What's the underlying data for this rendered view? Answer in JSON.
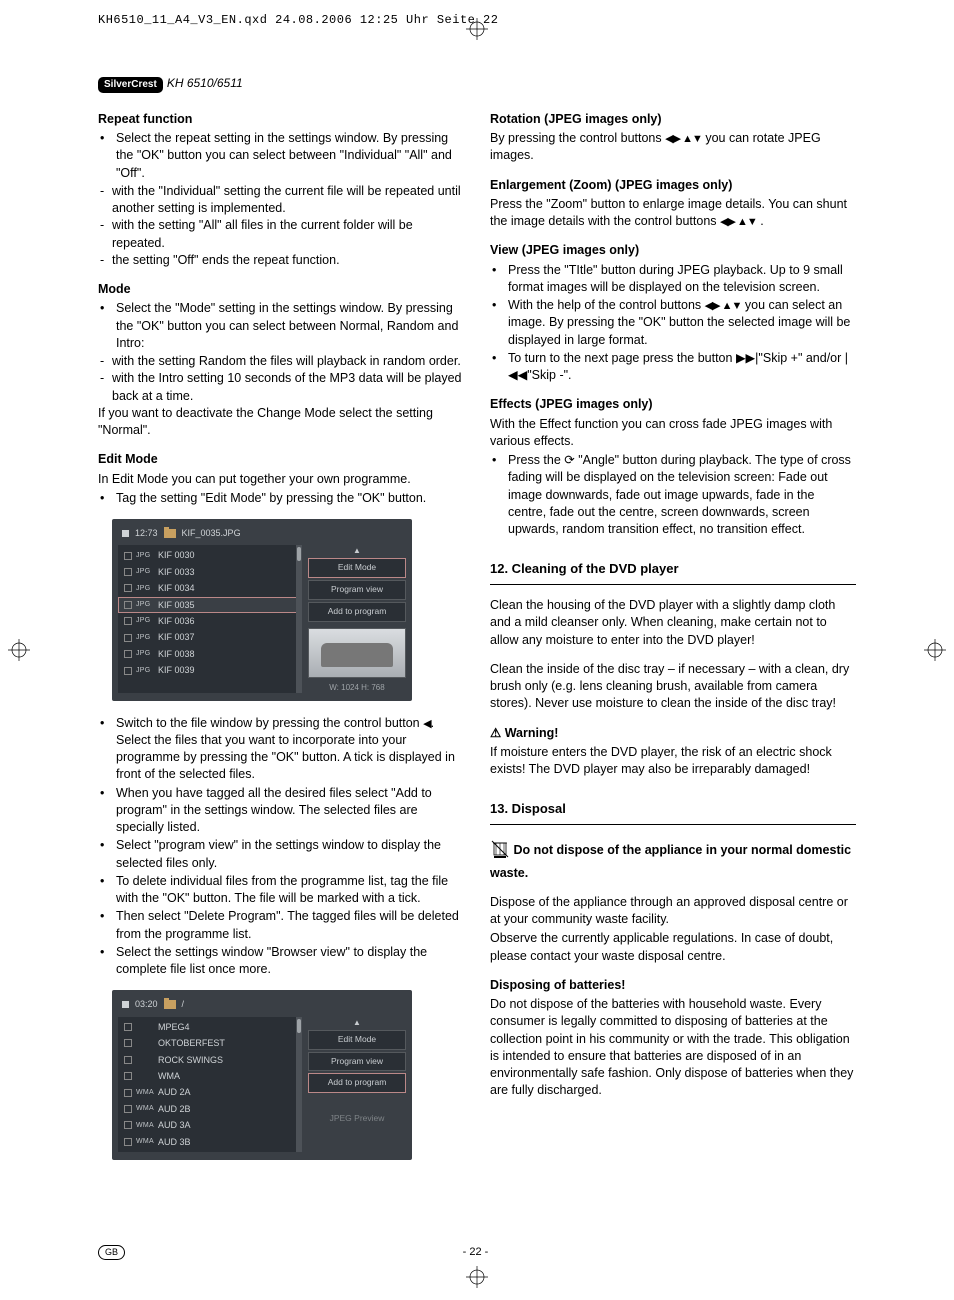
{
  "meta": {
    "crop_header": "KH6510_11_A4_V3_EN.qxd  24.08.2006  12:25 Uhr  Seite 22",
    "brand_badge": "SilverCrest",
    "model": "KH 6510/6511",
    "page_label": "- 22 -",
    "lang_badge": "GB"
  },
  "glyphs": {
    "lr": "◀▶",
    "ud": "▲▼",
    "left": "◀",
    "skip_fwd": "▶▶|",
    "skip_back": "|◀◀",
    "angle": "⟳",
    "warning": "⚠"
  },
  "left": {
    "repeat": {
      "title": "Repeat function",
      "b1": "Select the repeat setting in the settings window. By pressing the \"OK\" button you can select between \"Individual\" \"All\" and \"Off\".",
      "d1": "with the \"Individual\" setting the current file will be repeated until another setting is implemented.",
      "d2": "with the setting \"All\" all files in the current folder will be repeated.",
      "d3": "the setting \"Off\" ends the repeat function."
    },
    "mode": {
      "title": "Mode",
      "b1": "Select the \"Mode\" setting in the settings window. By pressing the \"OK\" button you can select between Normal, Random and Intro:",
      "d1": "with the setting Random the files will playback in random order.",
      "d2": "with the Intro setting 10 seconds of the MP3 data will be played back at a time.",
      "p1": "If you want to deactivate the Change Mode select the setting \"Normal\"."
    },
    "edit": {
      "title": "Edit Mode",
      "p1": "In Edit Mode you can put together your own programme.",
      "b1": "Tag the setting \"Edit Mode\" by pressing the \"OK\" button.",
      "b2a": "Switch to the file window by pressing the control button ",
      "b2b": ". Select the files that you want to incorporate into your programme by pressing the \"OK\" button. A tick is displayed in front of the selected files.",
      "b3": "When you have tagged all the desired files select \"Add to program\" in the settings window. The selected files are specially listed.",
      "b4": "Select \"program view\" in the settings window to display the selected files only.",
      "b5": "To delete individual files from the programme list, tag the file with the \"OK\" button. The file will be marked with a tick.",
      "b6": "Then select \"Delete Program\". The tagged files will be deleted from the programme list.",
      "b7": "Select the settings window \"Browser view\" to display the complete file list once more."
    }
  },
  "right": {
    "rotation": {
      "title": "Rotation (JPEG images only)",
      "p1a": "By pressing the control buttons ",
      "p1b": " you can rotate JPEG images."
    },
    "zoom": {
      "title": "Enlargement (Zoom) (JPEG images only)",
      "p1a": "Press the \"Zoom\" button to enlarge image details. You can shunt the image details with the control buttons ",
      "p1b": " ."
    },
    "view": {
      "title": "View (JPEG images only)",
      "b1": "Press the \"TItle\" button during JPEG playback. Up to 9 small format images will be displayed on the television screen.",
      "b2a": "With the help of the control buttons ",
      "b2b": " you can select an image. By pressing the \"OK\" button the selected image will be displayed in large format.",
      "b3a": "To turn to the next page press the button ",
      "b3b": "\"Skip +\" and/or ",
      "b3c": "\"Skip -\"."
    },
    "effects": {
      "title": "Effects (JPEG images only)",
      "p1": "With the Effect function you can cross fade JPEG images with various effects.",
      "b1a": "Press the ",
      "b1b": " \"Angle\" button during playback. The type of cross fading will be displayed on the television screen: Fade out image downwards, fade out image upwards, fade in the centre, fade out the centre, screen downwards, screen upwards, random transition effect, no transition effect."
    },
    "cleaning": {
      "title": "12. Cleaning of the DVD player",
      "p1": "Clean the housing of the DVD player with a slightly damp cloth and a mild cleanser only. When cleaning, make certain not to allow any moisture to enter into the DVD player!",
      "p2": "Clean the inside of the disc tray – if necessary –  with a clean, dry brush only (e.g. lens cleaning brush, available from camera stores). Never use moisture to clean the inside of the disc tray!",
      "warn_title": "Warning!",
      "warn_body": "If moisture enters the DVD player, the risk of an electric shock exists! The DVD player may also be irreparably damaged!"
    },
    "disposal": {
      "title": "13. Disposal",
      "bold": "Do not dispose of the appliance in your normal domestic waste.",
      "p1": "Dispose of the appliance through an approved disposal centre or at your community waste facility.",
      "p2": "Observe the currently applicable regulations. In case of doubt, please contact your waste disposal centre.",
      "bat_title": "Disposing of batteries!",
      "bat_body": "Do not dispose of the batteries with household waste. Every consumer is legally committed to disposing of batteries at the collection point in his community or with the trade. This obligation is intended to ensure that batteries are disposed of in an environmentally safe fashion. Only dispose of batteries when they are fully discharged."
    }
  },
  "ss1": {
    "counter": "12:73",
    "current": "KIF_0035.JPG",
    "btn1": "Edit Mode",
    "btn2": "Program view",
    "btn3": "Add to program",
    "dim": "W: 1024  H: 768",
    "files": [
      {
        "tag": "JPG",
        "name": "KIF  0030"
      },
      {
        "tag": "JPG",
        "name": "KIF  0033"
      },
      {
        "tag": "JPG",
        "name": "KIF  0034"
      },
      {
        "tag": "JPG",
        "name": "KIF  0035"
      },
      {
        "tag": "JPG",
        "name": "KIF  0036"
      },
      {
        "tag": "JPG",
        "name": "KIF  0037"
      },
      {
        "tag": "JPG",
        "name": "KIF  0038"
      },
      {
        "tag": "JPG",
        "name": "KIF  0039"
      }
    ],
    "selected_index": 3
  },
  "ss2": {
    "counter": "03:20",
    "current": "/",
    "btn1": "Edit Mode",
    "btn2": "Program view",
    "btn3": "Add to program",
    "preview": "JPEG Preview",
    "files": [
      {
        "tag": "",
        "name": "MPEG4"
      },
      {
        "tag": "",
        "name": "OKTOBERFEST"
      },
      {
        "tag": "",
        "name": "ROCK  SWINGS"
      },
      {
        "tag": "",
        "name": "WMA"
      },
      {
        "tag": "WMA",
        "name": "AUD  2A"
      },
      {
        "tag": "WMA",
        "name": "AUD  2B"
      },
      {
        "tag": "WMA",
        "name": "AUD  3A"
      },
      {
        "tag": "WMA",
        "name": "AUD  3B"
      }
    ],
    "selected_index": -1
  }
}
